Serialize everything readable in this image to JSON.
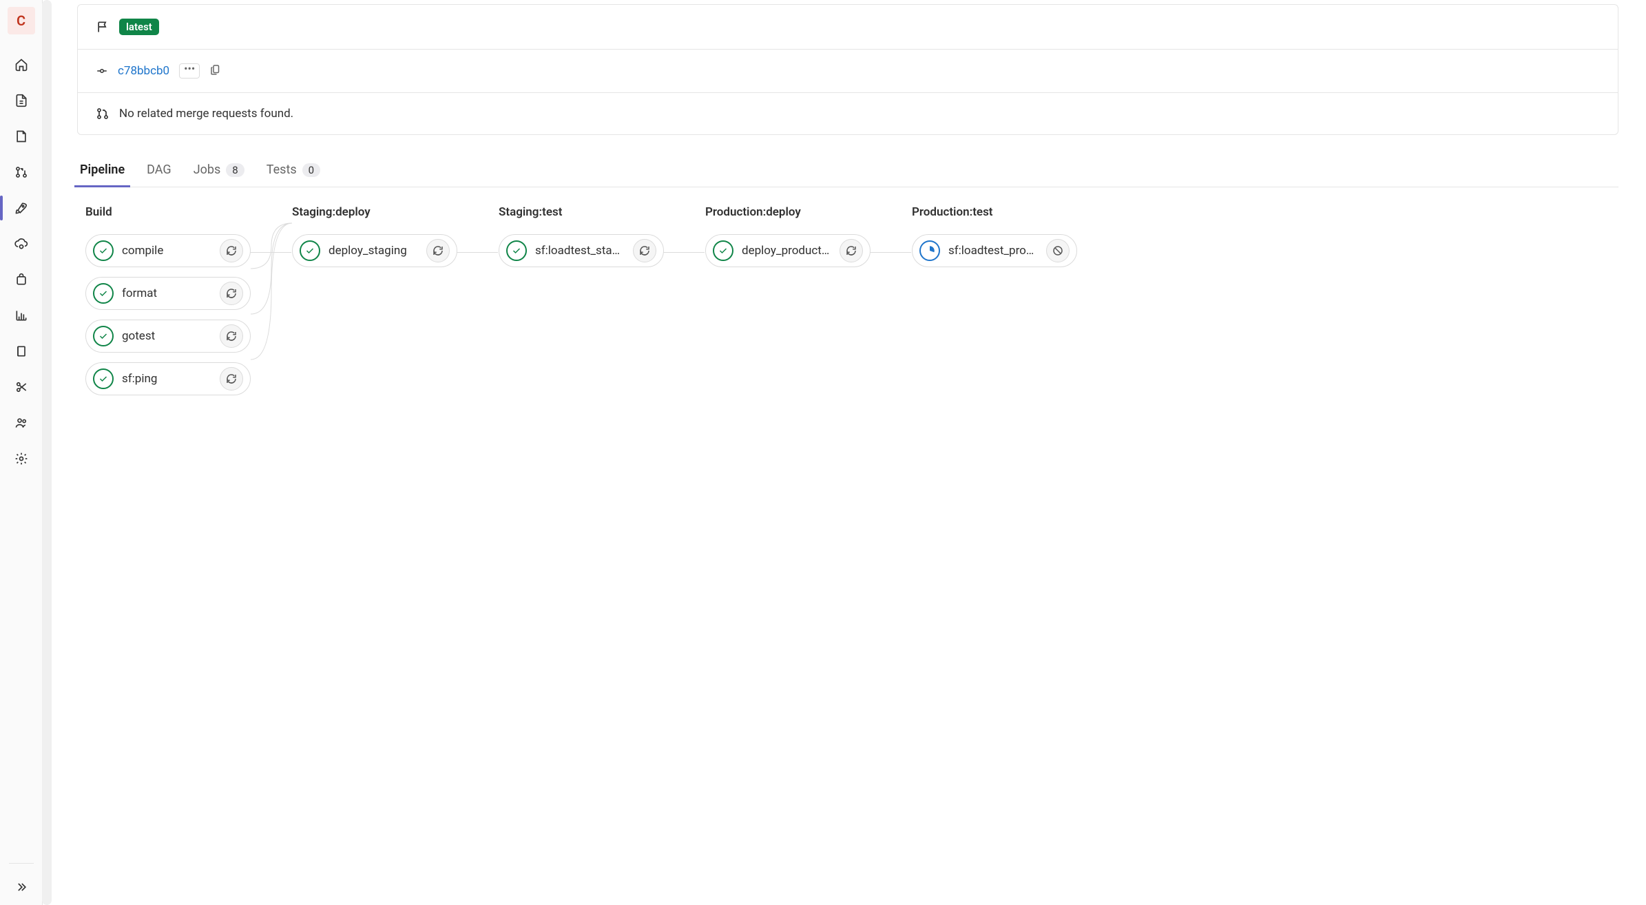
{
  "avatar_letter": "C",
  "header": {
    "badge": "latest",
    "commit_sha": "c78bbcb0",
    "mr_text": "No related merge requests found."
  },
  "tabs": {
    "pipeline": "Pipeline",
    "dag": "DAG",
    "jobs": "Jobs",
    "jobs_count": "8",
    "tests": "Tests",
    "tests_count": "0"
  },
  "stages": [
    {
      "title": "Build",
      "jobs": [
        {
          "name": "compile",
          "status": "success",
          "action": "retry"
        },
        {
          "name": "format",
          "status": "success",
          "action": "retry"
        },
        {
          "name": "gotest",
          "status": "success",
          "action": "retry"
        },
        {
          "name": "sf:ping",
          "status": "success",
          "action": "retry"
        }
      ]
    },
    {
      "title": "Staging:deploy",
      "jobs": [
        {
          "name": "deploy_staging",
          "status": "success",
          "action": "retry"
        }
      ]
    },
    {
      "title": "Staging:test",
      "jobs": [
        {
          "name": "sf:loadtest_sta…",
          "status": "success",
          "action": "retry"
        }
      ]
    },
    {
      "title": "Production:deploy",
      "jobs": [
        {
          "name": "deploy_product…",
          "status": "success",
          "action": "retry"
        }
      ]
    },
    {
      "title": "Production:test",
      "jobs": [
        {
          "name": "sf:loadtest_pro…",
          "status": "running",
          "action": "cancel"
        }
      ]
    }
  ]
}
